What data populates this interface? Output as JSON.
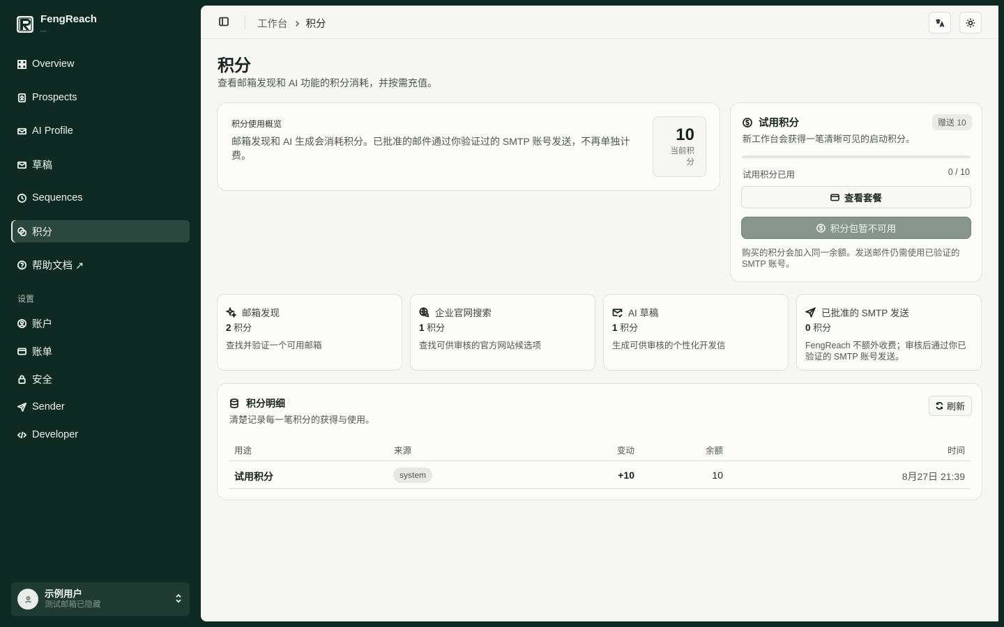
{
  "brand": {
    "name": "FengReach",
    "sub": "—"
  },
  "sidebar": {
    "nav": [
      {
        "label": "Overview",
        "icon": "dashboard-icon"
      },
      {
        "label": "Prospects",
        "icon": "contacts-icon"
      },
      {
        "label": "AI Profile",
        "icon": "mail-ai-icon"
      },
      {
        "label": "草稿",
        "icon": "draft-mail-icon"
      },
      {
        "label": "Sequences",
        "icon": "clock-icon"
      },
      {
        "label": "积分",
        "icon": "coins-icon",
        "active": true
      },
      {
        "label": "帮助文档 ↗",
        "icon": "help-circle-icon"
      }
    ],
    "settings_label": "设置",
    "settings": [
      {
        "label": "账户",
        "icon": "user-circle-icon"
      },
      {
        "label": "账单",
        "icon": "credit-card-icon"
      },
      {
        "label": "安全",
        "icon": "lock-icon"
      },
      {
        "label": "Sender",
        "icon": "send-icon"
      },
      {
        "label": "Developer",
        "icon": "code-icon"
      }
    ]
  },
  "user": {
    "name": "示例用户",
    "email": "测试邮箱已隐藏"
  },
  "topbar": {
    "breadcrumb_parent": "工作台",
    "breadcrumb_current": "积分"
  },
  "page": {
    "title": "积分",
    "subtitle": "查看邮箱发现和 AI 功能的积分消耗，并按需充值。"
  },
  "overview": {
    "label": "积分使用概览",
    "description": "邮箱发现和 AI 生成会消耗积分。已批准的邮件通过你验证过的 SMTP 账号发送，不再单独计费。",
    "balance": "10",
    "balance_label": "当前积分"
  },
  "trial": {
    "title": "试用积分",
    "badge": "赠送 10",
    "description": "新工作台会获得一笔清晰可见的启动积分。",
    "used_label": "试用积分已用",
    "used_count": "0 / 10",
    "used_fraction": 0,
    "plans_button": "查看套餐",
    "packs_button": "积分包暂不可用",
    "note": "购买的积分会加入同一余额。发送邮件仍需使用已验证的 SMTP 账号。"
  },
  "costs": [
    {
      "title": "邮箱发现",
      "icon": "sparkles-icon",
      "amount": "2",
      "unit": "积分",
      "desc": "查找并验证一个可用邮箱"
    },
    {
      "title": "企业官网搜索",
      "icon": "globe-search-icon",
      "amount": "1",
      "unit": "积分",
      "desc": "查找可供审核的官方网站候选项"
    },
    {
      "title": "AI 草稿",
      "icon": "mail-check-icon",
      "amount": "1",
      "unit": "积分",
      "desc": "生成可供审核的个性化开发信"
    },
    {
      "title": "已批准的 SMTP 发送",
      "icon": "send-icon",
      "amount": "0",
      "unit": "积分",
      "desc": "FengReach 不额外收费；审核后通过你已验证的 SMTP 账号发送。"
    }
  ],
  "ledger": {
    "title": "积分明细",
    "subtitle": "清楚记录每一笔积分的获得与使用。",
    "refresh_label": "刷新",
    "columns": {
      "use": "用途",
      "source": "来源",
      "change": "变动",
      "balance": "余额",
      "time": "时间"
    },
    "rows": [
      {
        "use": "试用积分",
        "source": "system",
        "change": "+10",
        "balance": "10",
        "time": "8月27日 21:39"
      }
    ]
  },
  "colors": {
    "sidebar_bg": "#0f2a22",
    "main_bg": "#f6f6f3",
    "accent_disabled": "#87958e"
  }
}
